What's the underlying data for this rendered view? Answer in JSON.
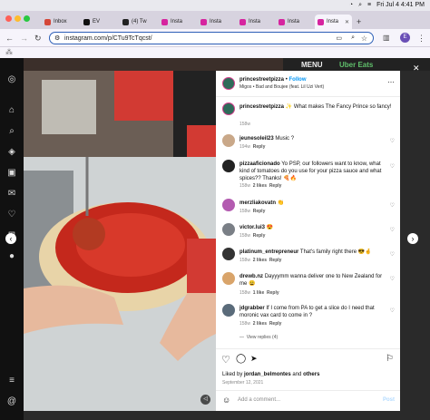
{
  "menubar": {
    "datetime": "Fri Jul 4  4:41 PM"
  },
  "browser": {
    "tabs": [
      {
        "label": "Inbox",
        "color": "#d44638"
      },
      {
        "label": "EV",
        "color": "#111111"
      },
      {
        "label": "(4) Tw",
        "color": "#222222"
      },
      {
        "label": "Insta",
        "color": "#d6249f"
      },
      {
        "label": "Insta",
        "color": "#d6249f"
      },
      {
        "label": "Insta",
        "color": "#d6249f"
      },
      {
        "label": "Insta",
        "color": "#d6249f"
      },
      {
        "label": "Insta",
        "color": "#d6249f"
      }
    ],
    "url": "instagram.com/p/CTu9TcTqcst/",
    "profile_initial": "E"
  },
  "background": {
    "menu_text": "MENU",
    "ubereats_text": "Uber Eats"
  },
  "post": {
    "username": "princestreetpizza",
    "follow": "Follow",
    "audio": "Migos • Bad and Boujee (feat. Lil Uzi Vert)",
    "caption": "What makes The Fancy Prince so fancy!",
    "caption_age": "158w"
  },
  "comments": [
    {
      "user": "jeunesoleil23",
      "text": "Music ?",
      "age": "194w",
      "likes": "",
      "reply": "Reply"
    },
    {
      "user": "pizzaaficionado",
      "text": "Yo PSP, our followers want to know, what kind of tomatoes do you use for your pizza sauce and what spices?? Thanks! 🍕🔥",
      "age": "158w",
      "likes": "2 likes",
      "reply": "Reply"
    },
    {
      "user": "merzliakovatn",
      "text": "👏",
      "age": "158w",
      "likes": "",
      "reply": "Reply"
    },
    {
      "user": "victor.lui3",
      "text": "😍",
      "age": "158w",
      "likes": "",
      "reply": "Reply"
    },
    {
      "user": "platinum_entrepreneur",
      "text": "That's family right there 😎🤞",
      "age": "158w",
      "likes": "2 likes",
      "reply": "Reply"
    },
    {
      "user": "drewb.nz",
      "text": "Dayyymm wanna deliver one to New Zealand for me 😩",
      "age": "158w",
      "likes": "1 like",
      "reply": "Reply"
    },
    {
      "user": "jdgrabber",
      "text": "If I come from PA to get a slice do I need that moronic vax card to come in ?",
      "age": "158w",
      "likes": "2 likes",
      "reply": "Reply"
    }
  ],
  "view_replies": "View replies (4)",
  "likes": {
    "prefix": "Liked by ",
    "user": "jordan_belmontes",
    "suffix": " and ",
    "others": "others"
  },
  "date": "September 12, 2021",
  "comment_box": {
    "placeholder": "Add a comment...",
    "post": "Post"
  }
}
